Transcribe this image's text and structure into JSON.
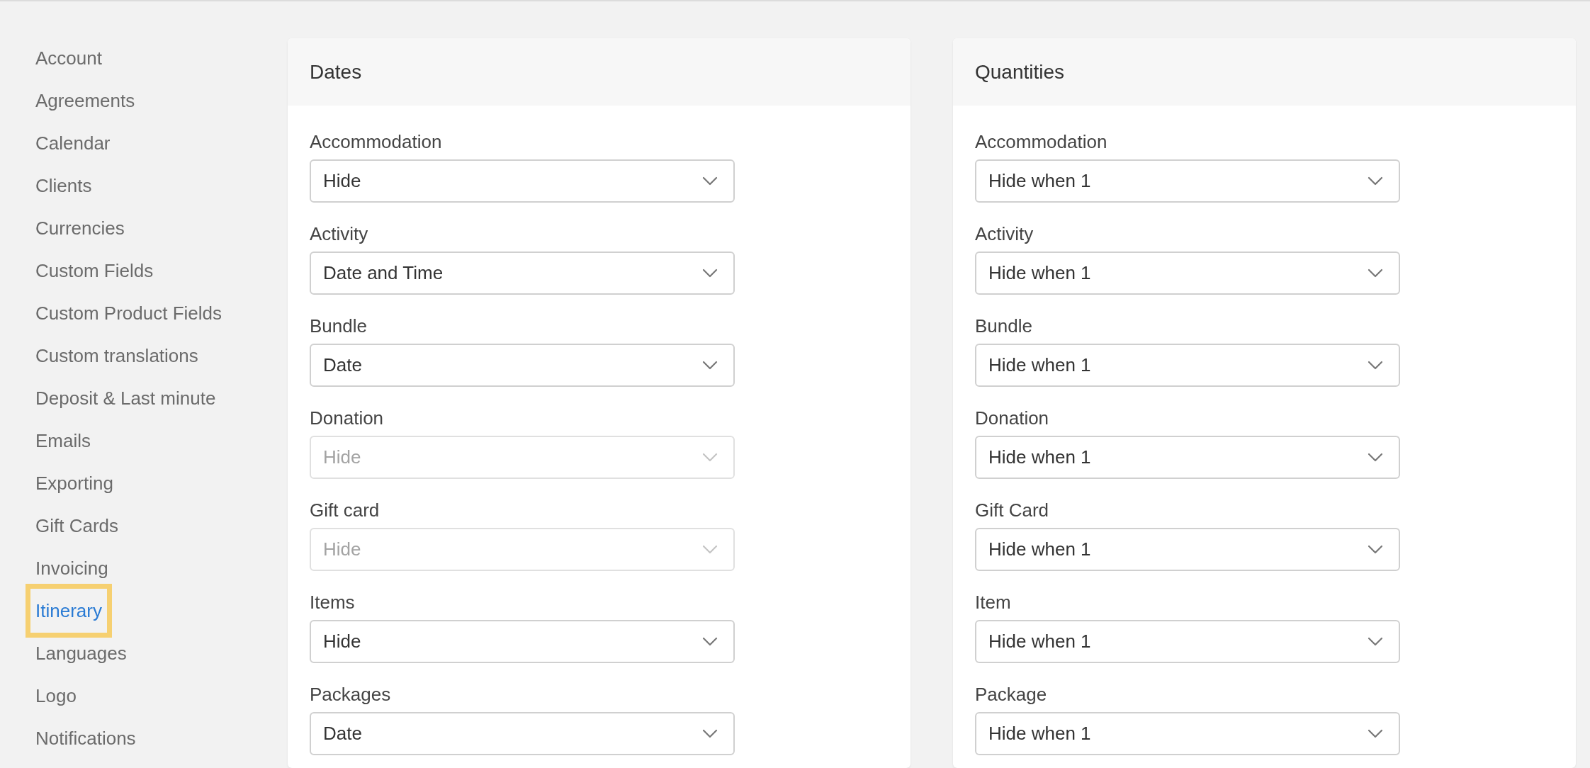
{
  "sidebar": {
    "items": [
      {
        "label": "Account",
        "selected": false
      },
      {
        "label": "Agreements",
        "selected": false
      },
      {
        "label": "Calendar",
        "selected": false
      },
      {
        "label": "Clients",
        "selected": false
      },
      {
        "label": "Currencies",
        "selected": false
      },
      {
        "label": "Custom Fields",
        "selected": false
      },
      {
        "label": "Custom Product Fields",
        "selected": false
      },
      {
        "label": "Custom translations",
        "selected": false
      },
      {
        "label": "Deposit & Last minute",
        "selected": false
      },
      {
        "label": "Emails",
        "selected": false
      },
      {
        "label": "Exporting",
        "selected": false
      },
      {
        "label": "Gift Cards",
        "selected": false
      },
      {
        "label": "Invoicing",
        "selected": false
      },
      {
        "label": "Itinerary",
        "selected": true
      },
      {
        "label": "Languages",
        "selected": false
      },
      {
        "label": "Logo",
        "selected": false
      },
      {
        "label": "Notifications",
        "selected": false
      }
    ]
  },
  "panels": [
    {
      "title": "Dates",
      "fields": [
        {
          "label": "Accommodation",
          "value": "Hide",
          "disabled": false
        },
        {
          "label": "Activity",
          "value": "Date and Time",
          "disabled": false
        },
        {
          "label": "Bundle",
          "value": "Date",
          "disabled": false
        },
        {
          "label": "Donation",
          "value": "Hide",
          "disabled": true
        },
        {
          "label": "Gift card",
          "value": "Hide",
          "disabled": true
        },
        {
          "label": "Items",
          "value": "Hide",
          "disabled": false
        },
        {
          "label": "Packages",
          "value": "Date",
          "disabled": false
        }
      ]
    },
    {
      "title": "Quantities",
      "fields": [
        {
          "label": "Accommodation",
          "value": "Hide when 1",
          "disabled": false
        },
        {
          "label": "Activity",
          "value": "Hide when 1",
          "disabled": false
        },
        {
          "label": "Bundle",
          "value": "Hide when 1",
          "disabled": false
        },
        {
          "label": "Donation",
          "value": "Hide when 1",
          "disabled": false
        },
        {
          "label": "Gift Card",
          "value": "Hide when 1",
          "disabled": false
        },
        {
          "label": "Item",
          "value": "Hide when 1",
          "disabled": false
        },
        {
          "label": "Package",
          "value": "Hide when 1",
          "disabled": false
        }
      ]
    }
  ]
}
